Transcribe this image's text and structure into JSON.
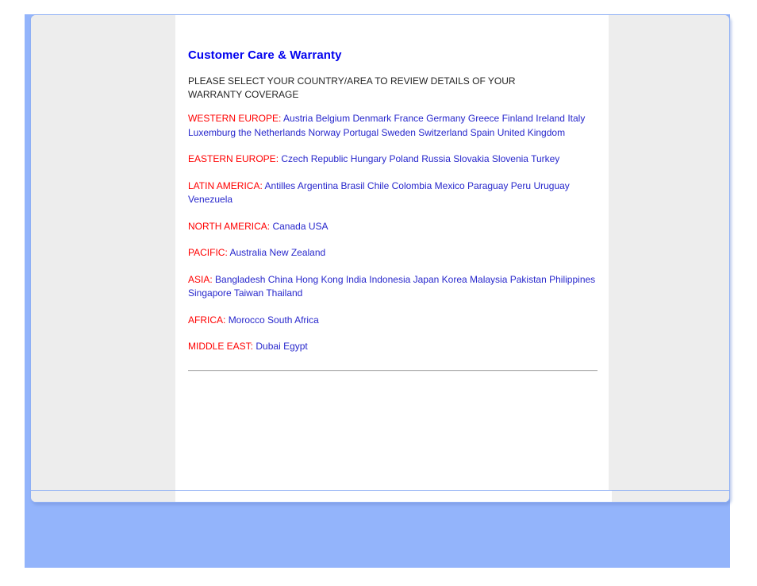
{
  "page": {
    "title": "Customer Care & Warranty",
    "intro": "PLEASE SELECT YOUR COUNTRY/AREA TO REVIEW DETAILS OF YOUR WARRANTY COVERAGE",
    "colors": {
      "heading": "#0000ee",
      "region_label": "#ff0000",
      "country_link": "#2727cc",
      "panel_border": "#8fb0f5",
      "backdrop": "#93b4fb",
      "rail": "#ededed"
    }
  },
  "regions": [
    {
      "label": "WESTERN EUROPE:",
      "countries": [
        "Austria",
        "Belgium",
        "Denmark",
        "France",
        "Germany",
        "Greece",
        "Finland",
        "Ireland",
        "Italy",
        "Luxemburg",
        "the Netherlands",
        "Norway",
        "Portugal",
        "Sweden",
        "Switzerland",
        "Spain",
        "United Kingdom"
      ]
    },
    {
      "label": "EASTERN EUROPE:",
      "countries": [
        "Czech Republic",
        "Hungary",
        "Poland",
        "Russia",
        "Slovakia",
        "Slovenia",
        "Turkey"
      ]
    },
    {
      "label": "LATIN AMERICA:",
      "countries": [
        "Antilles",
        "Argentina",
        "Brasil",
        "Chile",
        "Colombia",
        "Mexico",
        "Paraguay",
        "Peru",
        "Uruguay",
        "Venezuela"
      ]
    },
    {
      "label": "NORTH AMERICA:",
      "countries": [
        "Canada",
        "USA"
      ]
    },
    {
      "label": "PACIFIC:",
      "countries": [
        "Australia",
        "New Zealand"
      ]
    },
    {
      "label": "ASIA:",
      "countries": [
        "Bangladesh",
        "China",
        "Hong Kong",
        "India",
        "Indonesia",
        "Japan",
        "Korea",
        "Malaysia",
        "Pakistan",
        "Philippines",
        "Singapore",
        "Taiwan",
        "Thailand"
      ]
    },
    {
      "label": "AFRICA:",
      "countries": [
        "Morocco",
        "South Africa"
      ]
    },
    {
      "label": "MIDDLE EAST:",
      "countries": [
        "Dubai",
        "Egypt"
      ]
    }
  ]
}
